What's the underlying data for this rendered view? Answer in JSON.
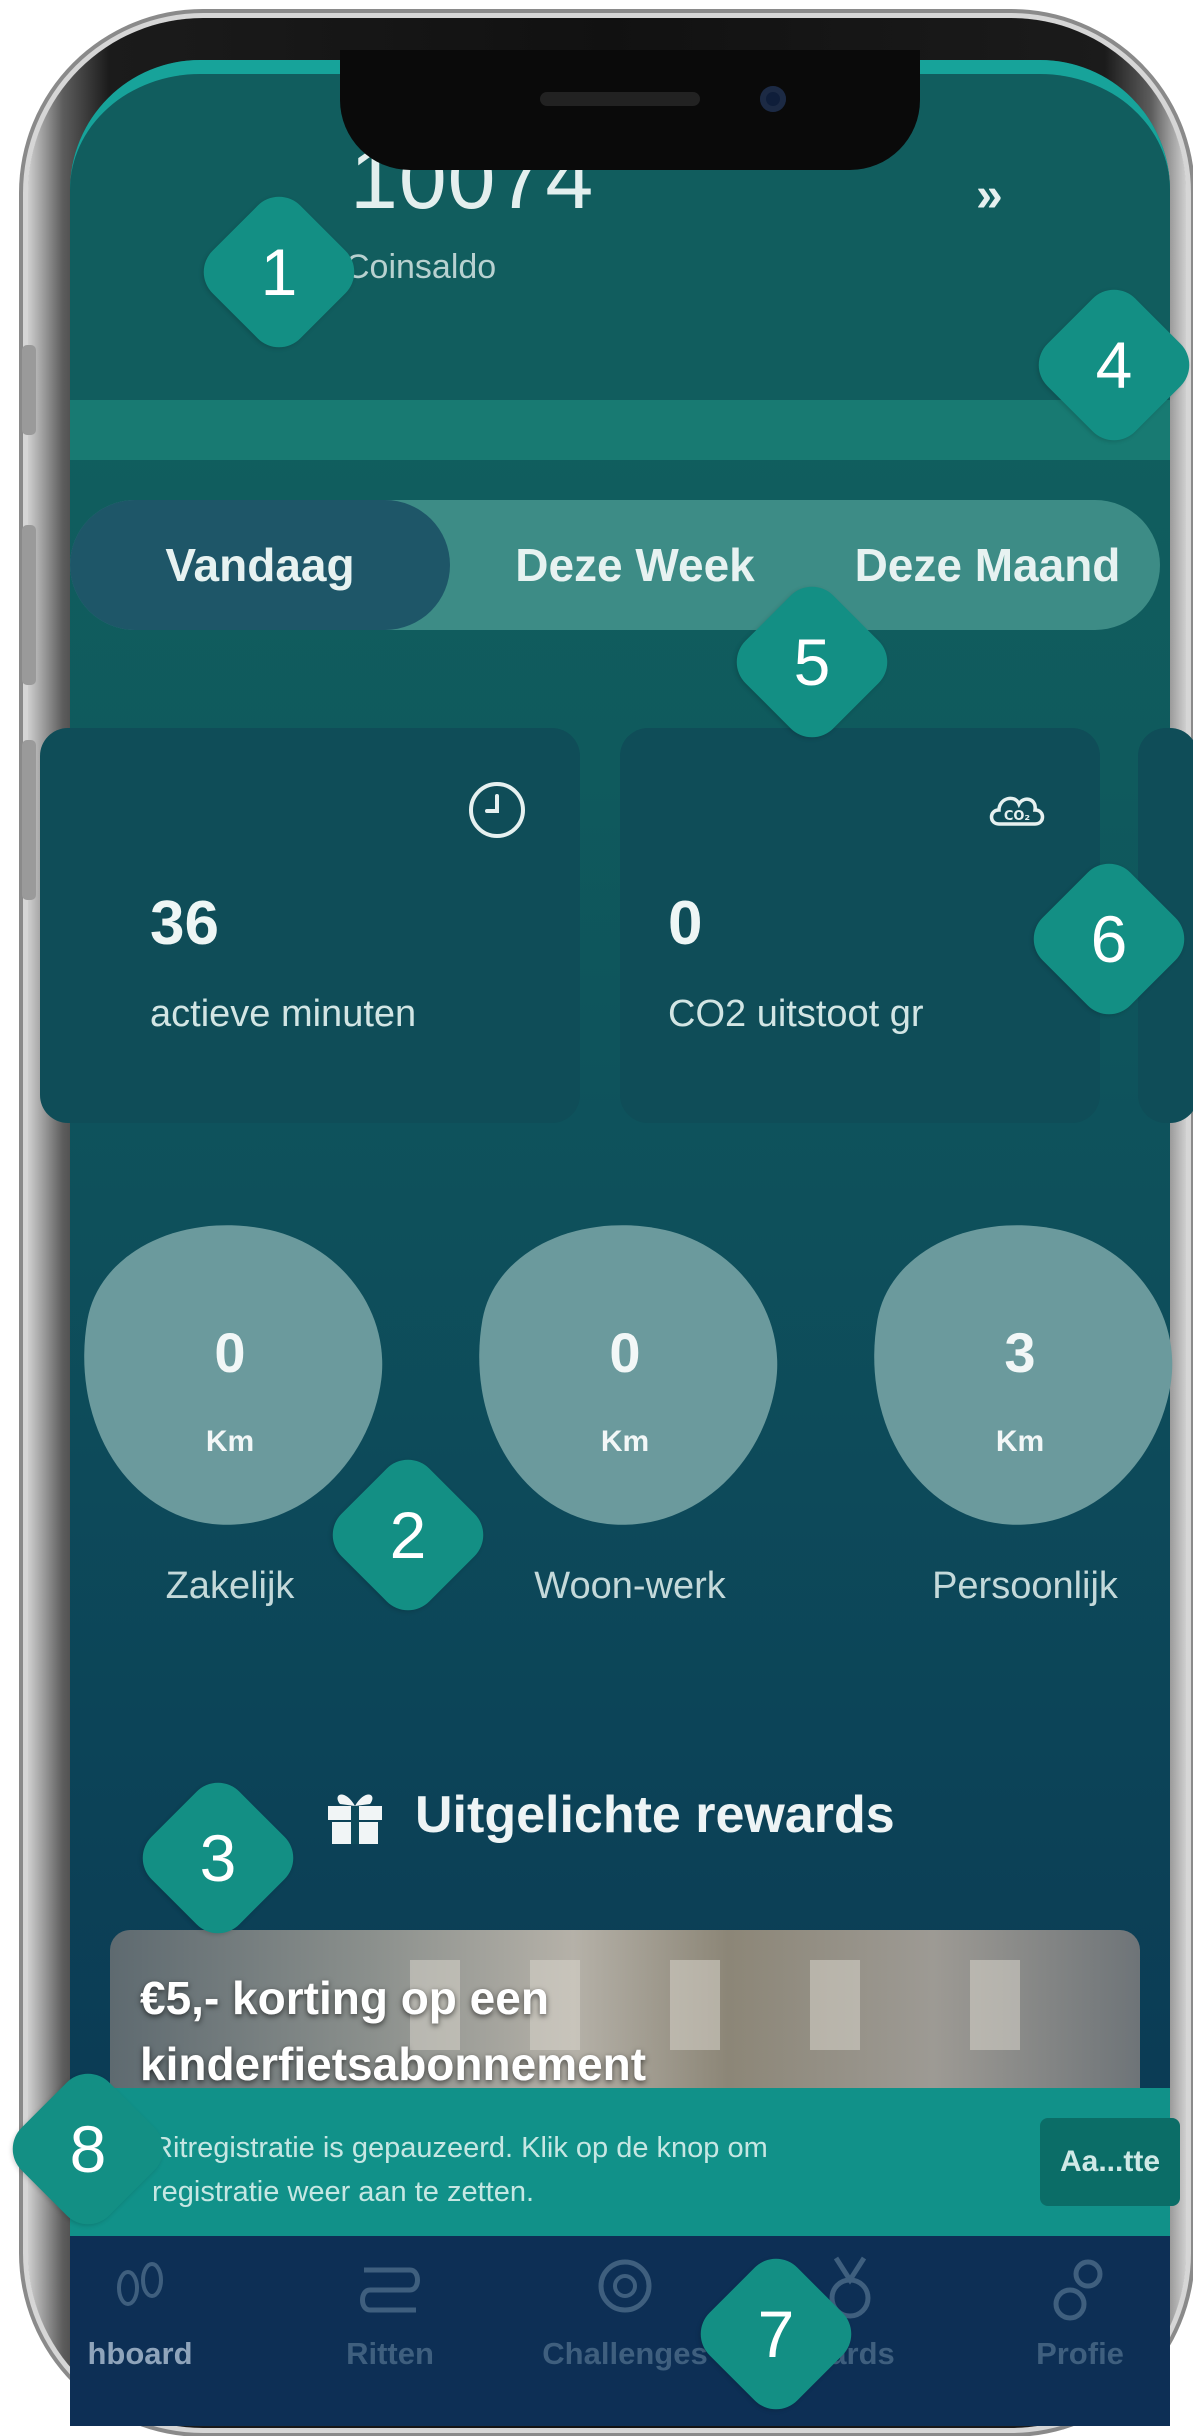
{
  "header": {
    "balance": "10074",
    "balance_label": "Coinsaldo",
    "more_icon": "chevrons-right-icon"
  },
  "period_tabs": [
    {
      "label": "Vandaag",
      "active": true
    },
    {
      "label": "Deze Week",
      "active": false
    },
    {
      "label": "Deze Maand",
      "active": false
    }
  ],
  "stats": [
    {
      "value": "36",
      "label": "actieve minuten",
      "icon": "clock-icon"
    },
    {
      "value": "0",
      "label": "CO2 uitstoot gr",
      "icon": "co2-cloud-icon"
    }
  ],
  "distances": [
    {
      "value": "0",
      "unit": "Km",
      "label": "Zakelijk"
    },
    {
      "value": "0",
      "unit": "Km",
      "label": "Woon-werk"
    },
    {
      "value": "3",
      "unit": "Km",
      "label": "Persoonlijk"
    }
  ],
  "rewards": {
    "title": "Uitgelichte rewards",
    "icon": "gift-icon",
    "featured": {
      "line1": "€5,- korting op een",
      "line2": "kinderfietsabonnement"
    }
  },
  "banner": {
    "line1": "Ritregistratie is gepauzeerd. Klik op de knop om",
    "line2": "registratie weer aan te zetten.",
    "button": "Aa...tte"
  },
  "nav": [
    {
      "label": "hboard",
      "icon": "footsteps-icon",
      "active": true
    },
    {
      "label": "Ritten",
      "icon": "route-icon",
      "active": false
    },
    {
      "label": "Challenges",
      "icon": "badge-icon",
      "active": false
    },
    {
      "label": "wards",
      "icon": "medal-icon",
      "active": false
    },
    {
      "label": "Profie",
      "icon": "profile-icon",
      "active": false
    }
  ],
  "markers": [
    "1",
    "2",
    "3",
    "4",
    "5",
    "6",
    "7",
    "8"
  ],
  "colors": {
    "accent": "#138f84",
    "screen_bg": "#0f5a5d",
    "tab_active": "#1e5668",
    "banner": "#119189",
    "nav_bg": "#0d2f55"
  }
}
